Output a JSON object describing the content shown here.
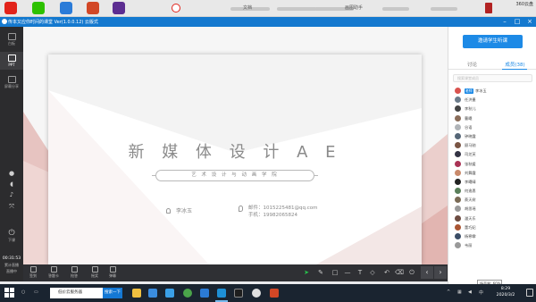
{
  "desktop": {
    "icon_texts": [
      "文档",
      "画图助手"
    ],
    "corner_label": "360云盘"
  },
  "app": {
    "title": "传本又应你时间的课堂 Ver(1.0.0.12) 云版式"
  },
  "rail": {
    "items": [
      {
        "label": "白板",
        "icon": "whiteboard-icon"
      },
      {
        "label": "PPT",
        "icon": "ppt-icon"
      },
      {
        "label": "屏幕分享",
        "icon": "screen-share-icon"
      }
    ],
    "timer": "00:31:53",
    "status1": "累计直播",
    "status2": "直播中"
  },
  "slide": {
    "title": "新 媒 体 设 计 A E",
    "subtitle": "艺 术 设 计 与 动 画 学 院",
    "teacher": "李冰玉",
    "email": "邮件：1015225481@qq.com",
    "phone": "手机：19982065824"
  },
  "toolbar": {
    "items": [
      "签到",
      "答题卡",
      "抢答",
      "摇奖",
      "弹幕"
    ],
    "nav_prev": "‹",
    "nav_next": "›"
  },
  "panel": {
    "invite_label": "邀请学生听课",
    "tab_discuss": "讨论",
    "tab_members": "成员(38)",
    "search_placeholder": "搜索课堂成员",
    "members": [
      {
        "name": "李冰玉",
        "tag": "老师",
        "color": "#d9534f"
      },
      {
        "name": "任洪墨",
        "color": "#6b7b8a"
      },
      {
        "name": "李秋儿",
        "color": "#444"
      },
      {
        "name": "曹曦",
        "color": "#8a6d5a"
      },
      {
        "name": "谷语",
        "color": "#b0b4b8"
      },
      {
        "name": "钟晓霞",
        "color": "#556677"
      },
      {
        "name": "顾马驰",
        "color": "#7a5544"
      },
      {
        "name": "司芝芙",
        "color": "#334"
      },
      {
        "name": "张秋媛",
        "color": "#aa3355"
      },
      {
        "name": "刘舞霞",
        "color": "#c98a6b"
      },
      {
        "name": "李曦晴",
        "color": "#222"
      },
      {
        "name": "何逸恩",
        "color": "#5a7f5a"
      },
      {
        "name": "蔡天树",
        "color": "#7a6a55"
      },
      {
        "name": "胡思瑶",
        "color": "#9a9a9a"
      },
      {
        "name": "潘天乐",
        "color": "#6d4c41"
      },
      {
        "name": "董巧妃",
        "color": "#aa5533"
      },
      {
        "name": "杨寒霏",
        "color": "#3b4d66"
      },
      {
        "name": "韦丽",
        "color": "#999"
      }
    ],
    "volume_tip": "扬声器: 60%"
  },
  "taskbar": {
    "search_text": "低价云服务器",
    "go_label": "搜索一下",
    "time": "8:29",
    "date": "2020/3/2"
  }
}
